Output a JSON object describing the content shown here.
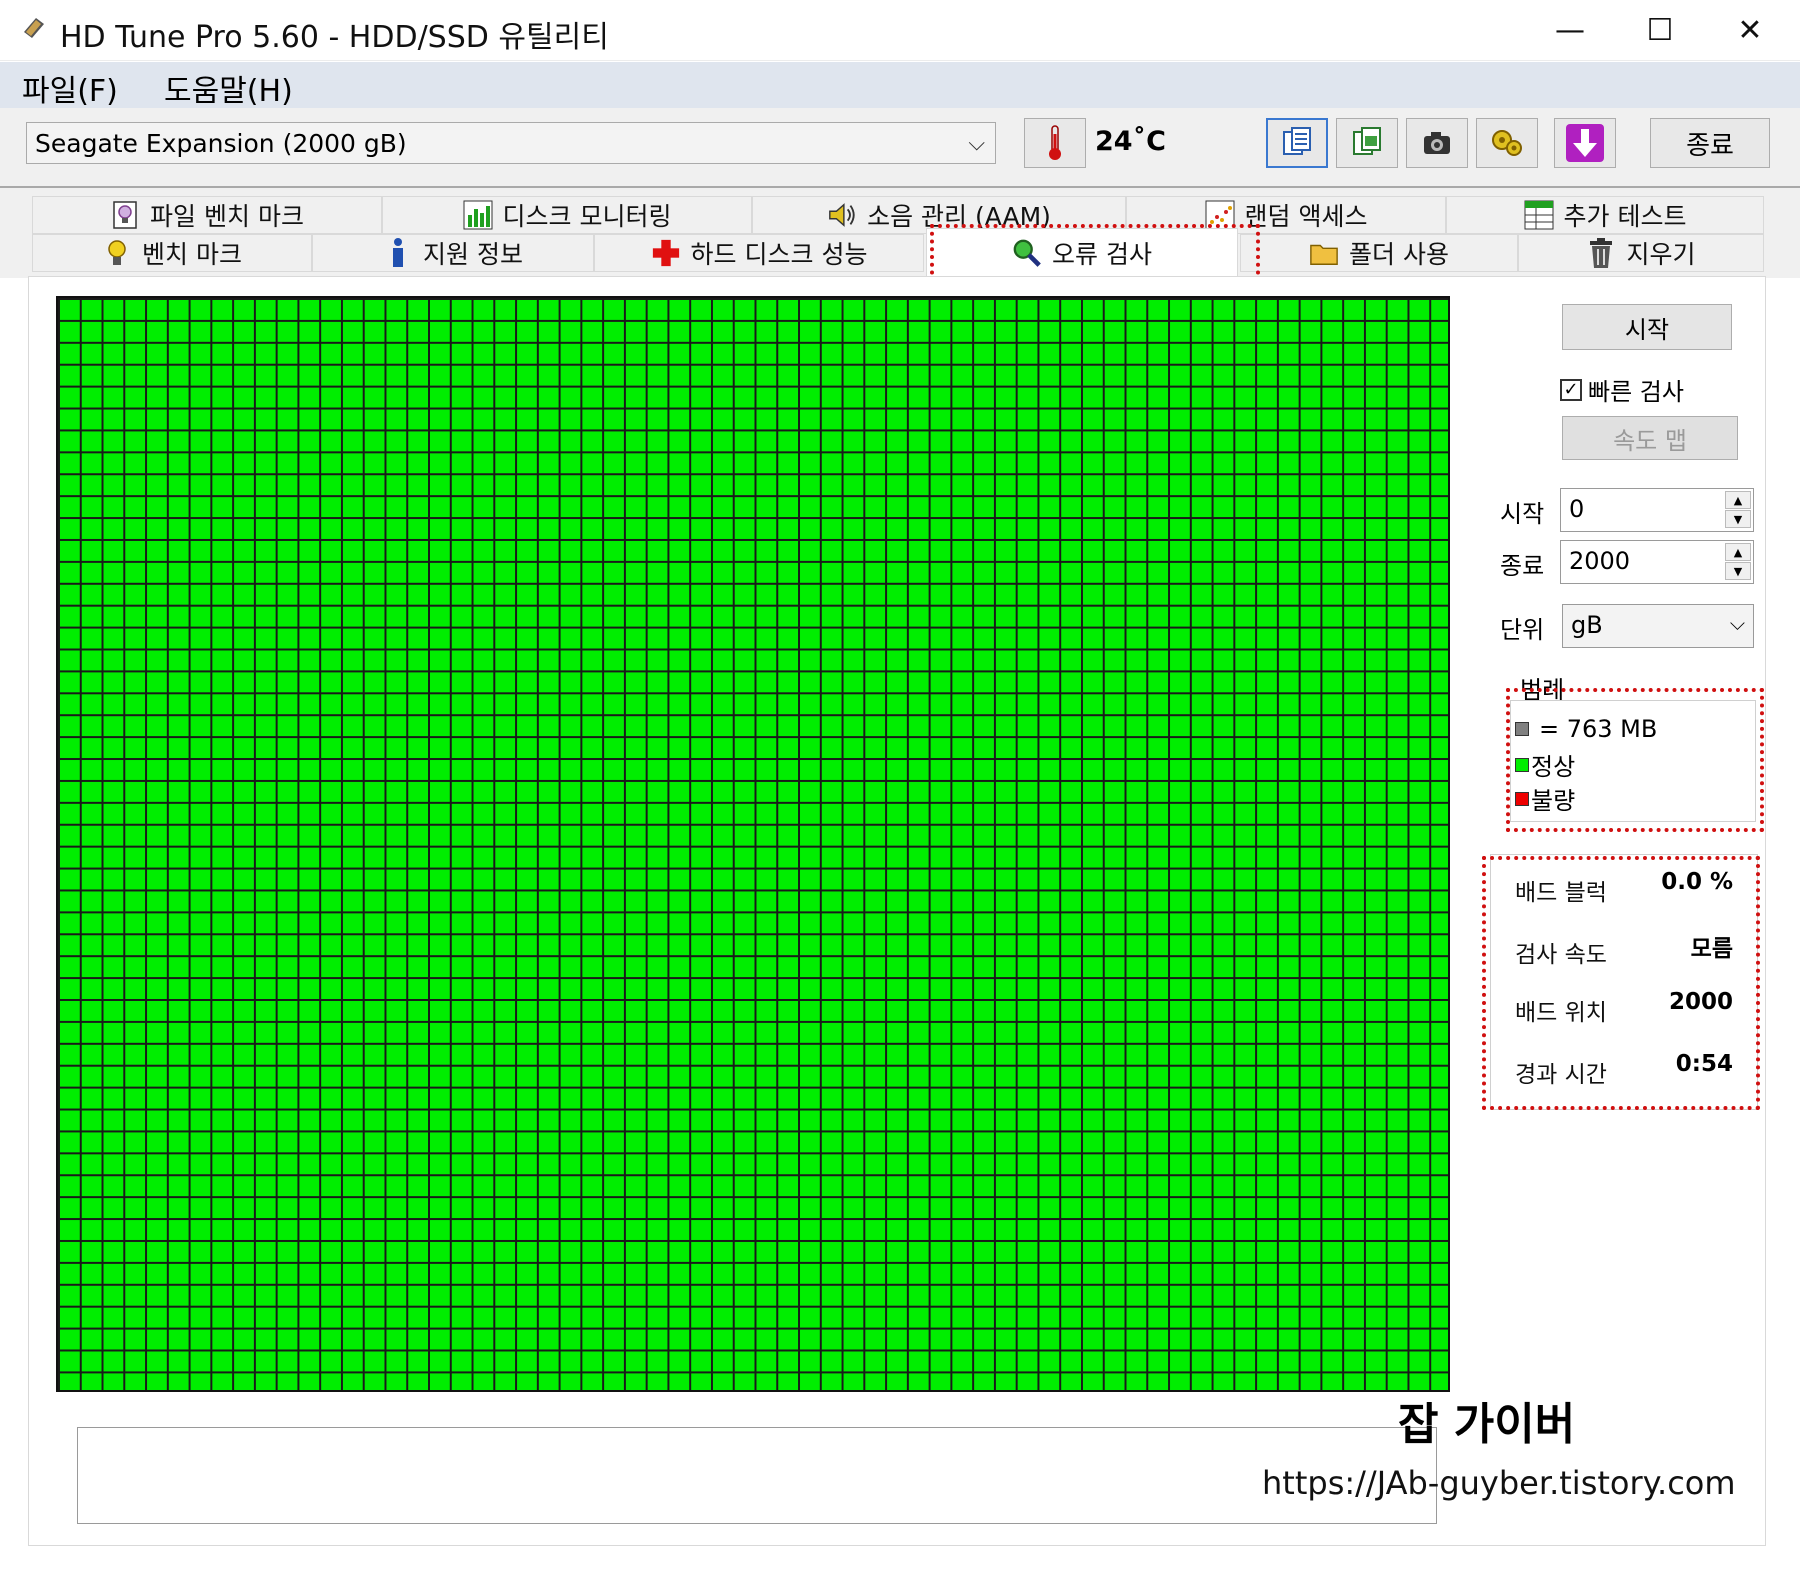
{
  "window": {
    "title": "HD Tune Pro 5.60 - HDD/SSD  유틸리티",
    "minimize": "—",
    "maximize": "☐",
    "close": "✕"
  },
  "menu": [
    "파일(F)",
    "도움말(H)"
  ],
  "toolbar": {
    "drive": "Seagate Expansion (2000 gB)",
    "temperature": "24˚C",
    "exit_label": "종료"
  },
  "tabs_top": [
    {
      "label": "파일 벤치 마크",
      "icon": "lightbulb-icon"
    },
    {
      "label": "디스크 모니터링",
      "icon": "bar-chart-icon"
    },
    {
      "label": "소음 관리 (AAM)",
      "icon": "speaker-icon"
    },
    {
      "label": "랜덤 액세스",
      "icon": "scatter-icon"
    },
    {
      "label": "추가 테스트",
      "icon": "table-icon"
    }
  ],
  "tabs_bottom": [
    {
      "label": "벤치 마크",
      "icon": "lightbulb-icon"
    },
    {
      "label": "지원 정보",
      "icon": "info-icon"
    },
    {
      "label": "하드 디스크 성능",
      "icon": "red-cross-icon"
    },
    {
      "label": "오류 검사",
      "icon": "magnifier-icon",
      "active": true
    },
    {
      "label": "폴더 사용",
      "icon": "folder-icon"
    },
    {
      "label": "지우기",
      "icon": "trash-icon"
    }
  ],
  "scan_grid": {
    "columns": 56,
    "rows": 50,
    "status": "정상",
    "fill_color": "#00ee00"
  },
  "controls": {
    "start_button": "시작",
    "quick_scan_label": "빠른 검사",
    "quick_scan_checked": true,
    "speed_map_button": "속도 맵",
    "start_label": "시작",
    "start_value": "0",
    "end_label": "종료",
    "end_value": "2000",
    "unit_label": "단위",
    "unit_value": "gB"
  },
  "legend": {
    "title": "범례",
    "items": [
      {
        "label": "= 763 MB",
        "color": "#808080"
      },
      {
        "label": "정상",
        "color": "#00ee00"
      },
      {
        "label": "불량",
        "color": "#ee0000"
      }
    ]
  },
  "stats": [
    {
      "label": "배드 블럭",
      "value": "0.0 %"
    },
    {
      "label": "검사 속도",
      "value": "모름"
    },
    {
      "label": "배드 위치",
      "value": "2000"
    },
    {
      "label": "경과 시간",
      "value": "0:54"
    }
  ],
  "watermark": {
    "brand": "잡 가이버",
    "url": "https://JAb-guyber.tistory.com"
  }
}
